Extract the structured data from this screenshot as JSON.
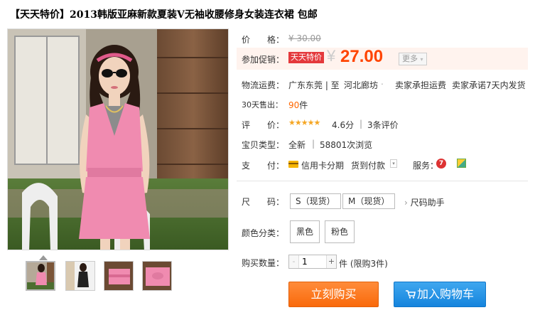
{
  "product": {
    "title": "【天天特价】2013韩版亚麻新款夏装V无袖收腰修身女装连衣裙 包邮"
  },
  "price": {
    "label": "价　　格：",
    "original": "¥ 30.00",
    "promo_label": "参加促销：",
    "promo_tag": "天天特价",
    "currency": "¥",
    "current": "27.00",
    "more": "更多"
  },
  "shipping": {
    "label": "物流运费：",
    "from": "广东东莞 | 至",
    "to": "河北廊坊",
    "fee": "卖家承担运费",
    "promise": "卖家承诺7天内发货"
  },
  "sales": {
    "label": "30天售出：",
    "count": "90",
    "unit": "件"
  },
  "rating": {
    "label": "评　　价：",
    "stars": "★★★★★",
    "score": "4.6分",
    "sep": "|",
    "reviews": "3条评价"
  },
  "item_type": {
    "label": "宝贝类型：",
    "condition": "全新",
    "sep": "|",
    "views": "58801次浏览"
  },
  "payment": {
    "label": "支　　付：",
    "credit": "信用卡分期",
    "cod": "货到付款",
    "service_label": "服务："
  },
  "size": {
    "label": "尺　　码：",
    "options": [
      "S（现货）",
      "M（现货）"
    ],
    "helper": "尺码助手"
  },
  "color": {
    "label": "颜色分类：",
    "options": [
      "黑色",
      "粉色"
    ]
  },
  "quantity": {
    "label": "购买数量：",
    "minus": "-",
    "value": "1",
    "plus": "+",
    "unit": "件 (限购3件)"
  },
  "actions": {
    "buy": "立刻购买",
    "cart": "加入购物车"
  },
  "colors": {
    "price_red": "#ff4400",
    "promo_red": "#e4393c",
    "buy_orange": "#f96a0b",
    "cart_blue": "#1584dd",
    "sales_orange": "#f60"
  },
  "icons": [
    "chevron-down-icon",
    "credit-card-icon",
    "service-badge-icon",
    "cart-icon"
  ]
}
